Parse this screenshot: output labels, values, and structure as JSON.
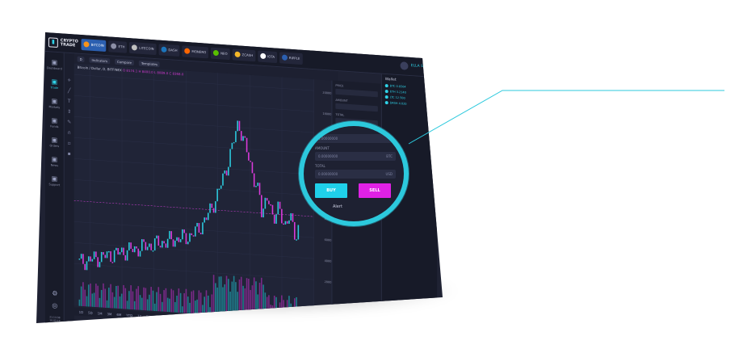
{
  "colors": {
    "accent_cyan": "#2cc9dd",
    "buy": "#1fd0ea",
    "sell": "#e021e6",
    "background": "#1f2233"
  },
  "logo": {
    "line1": "CRYPTO",
    "line2": "TRADE",
    "icon": "logo-icon"
  },
  "tabs": [
    {
      "label": "BITCOIN",
      "active": true,
      "color": "#f7931a"
    },
    {
      "label": "ETH",
      "active": false,
      "color": "#8c8fa6"
    },
    {
      "label": "LITECOIN",
      "active": false,
      "color": "#c0c0c0"
    },
    {
      "label": "DASH",
      "active": false,
      "color": "#1c75bc"
    },
    {
      "label": "MONERO",
      "active": false,
      "color": "#ff6600"
    },
    {
      "label": "NEO",
      "active": false,
      "color": "#58bf00"
    },
    {
      "label": "ZCASH",
      "active": false,
      "color": "#f4b728"
    },
    {
      "label": "IOTA",
      "active": false,
      "color": "#ffffff"
    },
    {
      "label": "RIPPLE",
      "active": false,
      "color": "#2b5fb0"
    }
  ],
  "user": {
    "name": "ELLA SMITH"
  },
  "sidebar": {
    "items": [
      {
        "label": "Dashboard",
        "icon": "dashboard-icon"
      },
      {
        "label": "Trade",
        "icon": "trade-icon"
      },
      {
        "label": "Markets",
        "icon": "markets-icon"
      },
      {
        "label": "Funds",
        "icon": "funds-icon"
      },
      {
        "label": "Orders",
        "icon": "orders-icon"
      },
      {
        "label": "News",
        "icon": "news-icon"
      },
      {
        "label": "Support",
        "icon": "support-icon"
      }
    ],
    "clock": [
      "21:14:38",
      "10.03.18"
    ]
  },
  "chart": {
    "title": "Bitcoin / Dollar, D, BITFINEX",
    "ohlc": "O 8174.1  H 8400.0  L 8089.0  C 8368.0",
    "toolbar": [
      "D",
      "Indicators",
      "Compare",
      "Templates"
    ],
    "price_ticks": [
      "20000",
      "18000",
      "16000",
      "14000",
      "12000",
      "10000",
      "8000",
      "6000",
      "4000",
      "2000"
    ],
    "bottom_ranges": [
      "1D",
      "5D",
      "1M",
      "3M",
      "6M",
      "YTD",
      "1Y",
      "5Y",
      "All"
    ]
  },
  "order_panel": {
    "labels": [
      "PRICE",
      "AMOUNT",
      "TOTAL"
    ]
  },
  "zoom": {
    "price_value": "0.00000000",
    "amount_label": "AMOUNT",
    "amount_value": "0.00000000",
    "amount_unit": "BTC",
    "total_label": "TOTAL",
    "total_value": "0.00000000",
    "total_unit": "USD",
    "buy_label": "BUY",
    "sell_label": "SELL",
    "alert_label": "Alert"
  },
  "right_panel": {
    "title": "Wallet",
    "rows": [
      "BTC 0.8564",
      "ETH 3.2140",
      "LTC 12.500",
      "DASH 4.020"
    ]
  }
}
